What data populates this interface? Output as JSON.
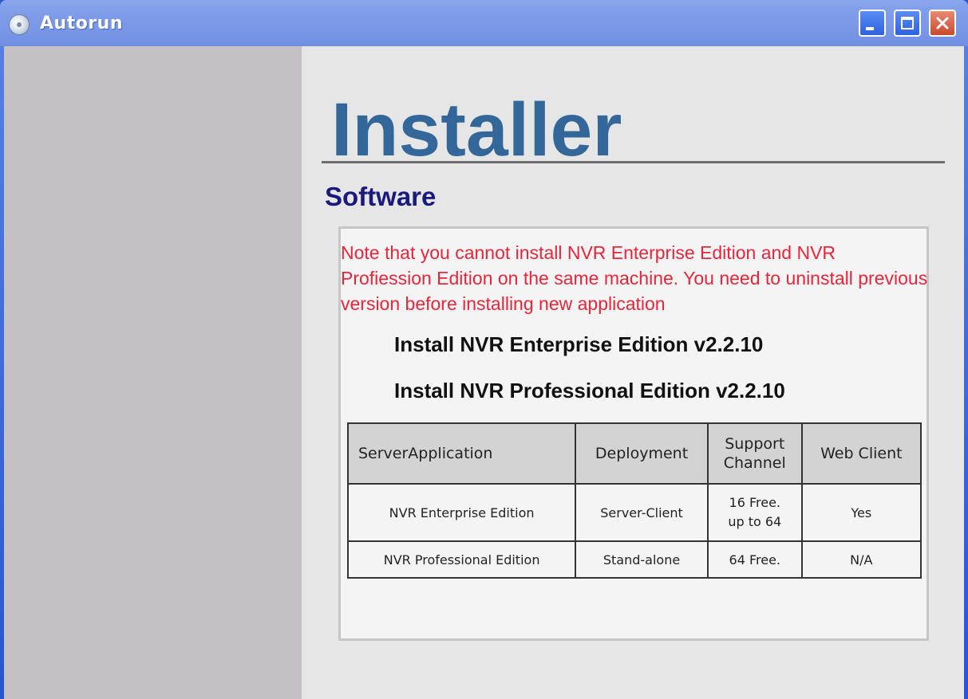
{
  "window": {
    "title": "Autorun",
    "icon": "cd-disc-icon"
  },
  "main": {
    "heading": "Installer",
    "subheading": "Software",
    "note": "Note that you cannot install NVR Enterprise Edition and NVR Profiession Edition on the same machine. You need to uninstall previous version before installing new application",
    "links": [
      "Install NVR Enterprise Edition v2.2.10",
      "Install NVR Professional Edition v2.2.10"
    ],
    "table": {
      "headers": [
        "ServerApplication",
        "Deployment",
        "Support",
        "Channel",
        "Web Client"
      ],
      "rows": [
        [
          "NVR Enterprise Edition",
          "Server-Client",
          "16 Free.",
          "up to 64",
          "Yes"
        ],
        [
          "NVR Professional Edition",
          "Stand-alone",
          "64 Free.",
          "N/A"
        ]
      ]
    }
  },
  "colors": {
    "heading": "#336699",
    "subheading": "#1a1a7e",
    "note": "#e8253a",
    "titlebar": "#7a98e6",
    "left_panel": "#c3c1c3"
  }
}
